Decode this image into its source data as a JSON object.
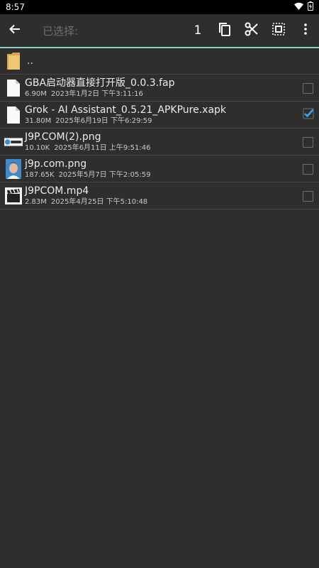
{
  "status_bar": {
    "time": "8:57",
    "icons": [
      "wifi-icon",
      "battery-icon"
    ]
  },
  "toolbar": {
    "title": "已选择:",
    "selected_count": "1",
    "icons": [
      "back-arrow-icon",
      "copy-icon",
      "cut-icon",
      "select-all-icon",
      "more-vert-icon"
    ]
  },
  "colors": {
    "background": "#2e2e2e",
    "accent": "#8ad2c8",
    "checkbox_checked": "#3ba3e6"
  },
  "files": {
    "parent": {
      "label": ".."
    },
    "items": [
      {
        "name": "GBA启动器直接打开版_0.0.3.fap",
        "size": "6.90M",
        "date": "2023年1月2日 下午3:11:16",
        "icon": "document-file-icon",
        "checked": false
      },
      {
        "name": "Grok - AI Assistant_0.5.21_APKPure.xapk",
        "size": "31.80M",
        "date": "2025年6月19日 下午6:29:59",
        "icon": "document-file-icon",
        "checked": true
      },
      {
        "name": "J9P.COM(2).png",
        "size": "10.10K",
        "date": "2025年6月11日 上午9:51:46",
        "icon": "image-thumbnail-icon",
        "checked": false
      },
      {
        "name": "j9p.com.png",
        "size": "187.65K",
        "date": "2025年5月7日 下午2:05:59",
        "icon": "photo-thumbnail-icon",
        "checked": false
      },
      {
        "name": "J9PCOM.mp4",
        "size": "2.83M",
        "date": "2025年4月25日 下午5:10:48",
        "icon": "video-clapper-icon",
        "checked": false
      }
    ]
  }
}
